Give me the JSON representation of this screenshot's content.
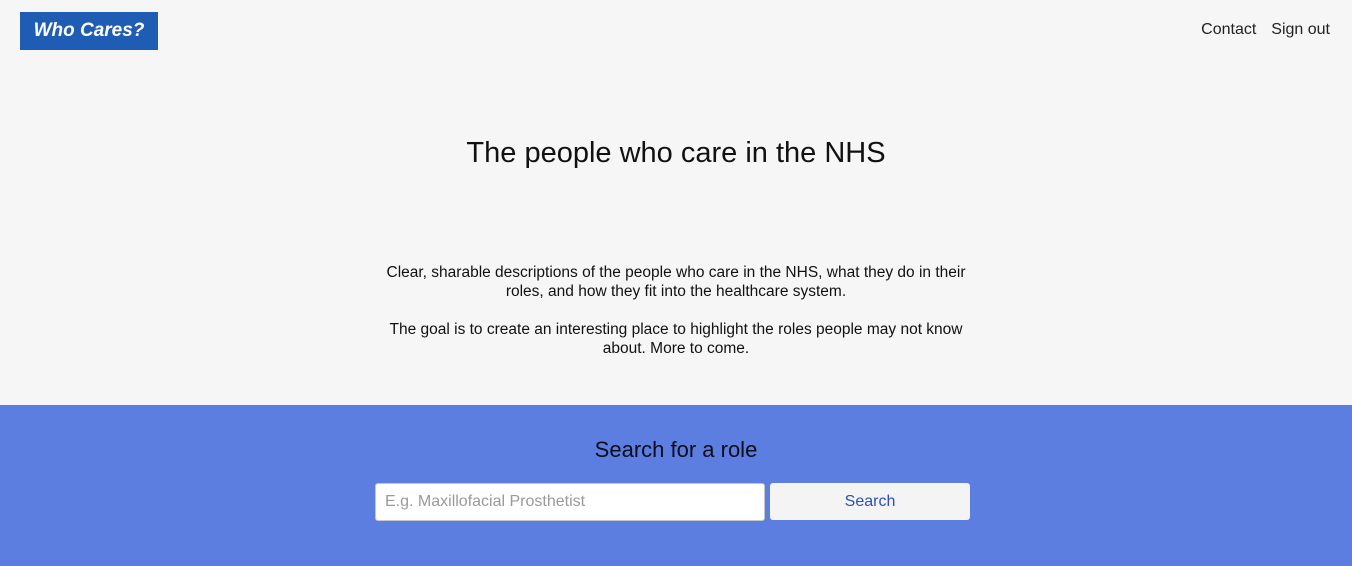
{
  "header": {
    "logo_text": "Who Cares?",
    "nav": {
      "contact": "Contact",
      "sign_out": "Sign out"
    }
  },
  "hero": {
    "title": "The people who care in the NHS",
    "paragraphs": [
      "Clear, sharable descriptions of the people who care in the NHS, what they do in their roles, and how they fit into the healthcare system.",
      "The goal is to create an interesting place to highlight the roles people may not know about. More to come."
    ]
  },
  "search": {
    "title": "Search for a role",
    "placeholder": "E.g. Maxillofacial Prosthetist",
    "value": "",
    "button_label": "Search"
  },
  "colors": {
    "logo_background": "#1f5db5",
    "page_background": "#f6f6f6",
    "search_band": "#5c7ee0",
    "search_button_text": "#2c4fb8"
  }
}
